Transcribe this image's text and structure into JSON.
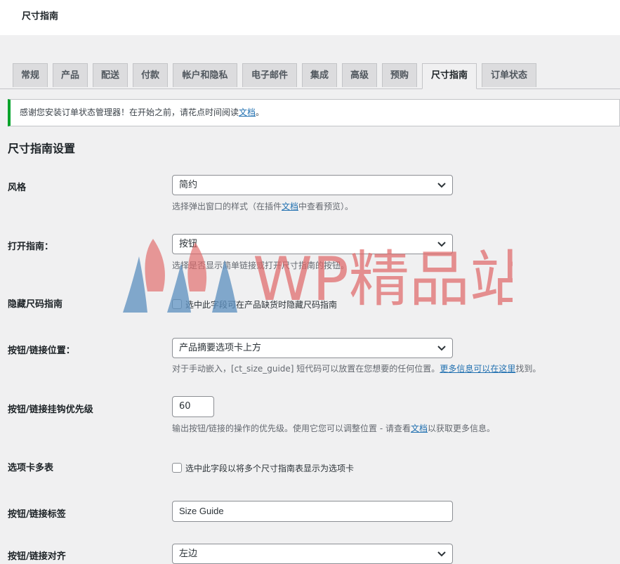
{
  "page": {
    "title": "尺寸指南"
  },
  "tabs": [
    {
      "label": "常规"
    },
    {
      "label": "产品"
    },
    {
      "label": "配送"
    },
    {
      "label": "付款"
    },
    {
      "label": "帐户和隐私"
    },
    {
      "label": "电子邮件"
    },
    {
      "label": "集成"
    },
    {
      "label": "高级"
    },
    {
      "label": "预购"
    },
    {
      "label": "尺寸指南",
      "active": true
    },
    {
      "label": "订单状态"
    }
  ],
  "notice": {
    "text_before": "感谢您安装订单状态管理器！在开始之前，请花点时间阅读",
    "link": "文档",
    "text_after": "。",
    "accent_color": "#00a32a"
  },
  "settings": {
    "section_title": "尺寸指南设置",
    "style": {
      "label": "风格",
      "value": "简约",
      "desc_before": "选择弹出窗口的样式（在插件",
      "desc_link": "文档",
      "desc_after": "中查看预览）。"
    },
    "open_guide": {
      "label": "打开指南：",
      "value": "按钮",
      "desc": "选择是否显示简单链接或打开尺寸指南的按钮。"
    },
    "hide_guide": {
      "label": "隐藏尺码指南",
      "checkbox_label": "选中此字段可在产品缺货时隐藏尺码指南"
    },
    "button_position": {
      "label": "按钮/链接位置：",
      "value": "产品摘要选项卡上方",
      "desc_before": "对于手动嵌入，[ct_size_guide] 短代码可以放置在您想要的任何位置。",
      "desc_link": "更多信息可以在这里",
      "desc_after": "找到。"
    },
    "hook_priority": {
      "label": "按钮/链接挂钩优先级",
      "value": "60",
      "desc_before": "输出按钮/链接的操作的优先级。使用它您可以调整位置 - 请查看",
      "desc_link": "文档",
      "desc_after": "以获取更多信息。"
    },
    "multi_tables": {
      "label": "选项卡多表",
      "checkbox_label": "选中此字段以将多个尺寸指南表显示为选项卡"
    },
    "button_label": {
      "label": "按钮/链接标签",
      "value": "Size Guide"
    },
    "button_align": {
      "label": "按钮/链接对齐",
      "value": "左边"
    }
  },
  "watermark": {
    "text": "WP精品站",
    "text_color": "#e06666",
    "drop_color": "#5b8fbf"
  },
  "colors": {
    "link": "#2271b1",
    "accent": "#00a32a"
  }
}
